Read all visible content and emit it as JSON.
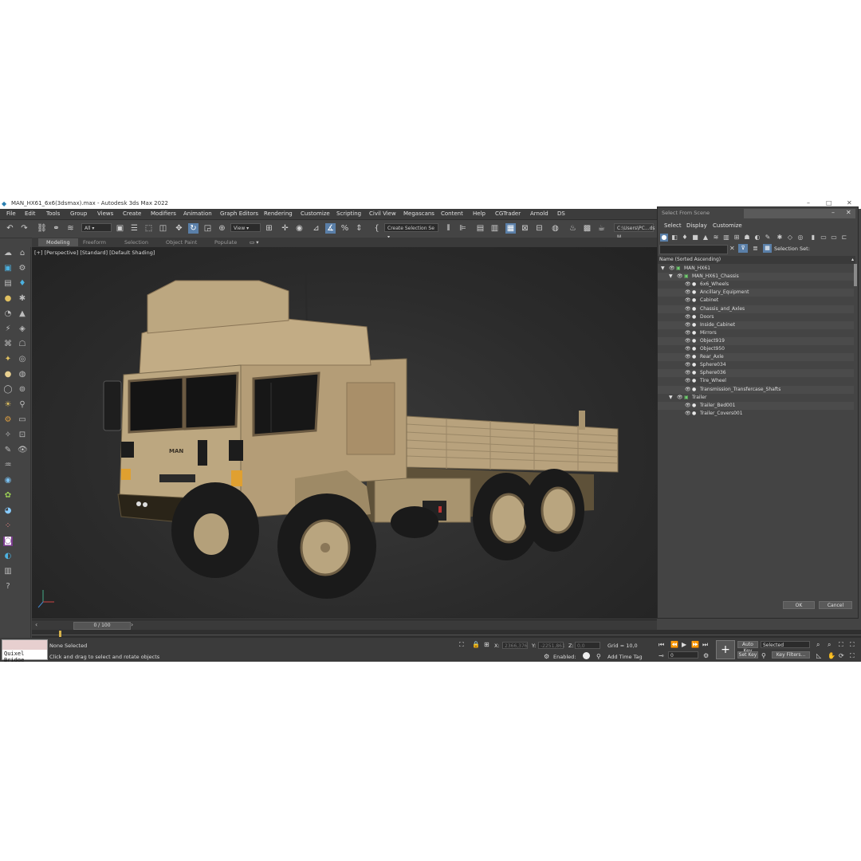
{
  "window": {
    "title": "MAN_HX61_6x6(3dsmax).max - Autodesk 3ds Max 2022"
  },
  "menu": [
    "File",
    "Edit",
    "Tools",
    "Group",
    "Views",
    "Create",
    "Modifiers",
    "Animation",
    "Graph Editors",
    "Rendering",
    "Customize",
    "Scripting",
    "Civil View",
    "Megascans",
    "Content",
    "Help",
    "CGTrader",
    "Arnold",
    "DS"
  ],
  "toolbar": {
    "filter_value": "All",
    "ref_coord_value": "View",
    "named_selection": "Create Selection Se",
    "path": "C:\\Users\\PC...ds M"
  },
  "ribbon": {
    "tabs": [
      "Modeling",
      "Freeform",
      "Selection",
      "Object Paint",
      "Populate"
    ]
  },
  "viewport": {
    "label": "[+] [Perspective] [Standard] [Default Shading]"
  },
  "timeline": {
    "frame": "0 / 100"
  },
  "status": {
    "quixel": "Quixel Bridge",
    "selection": "None Selected",
    "prompt": "Click and drag to select and rotate objects",
    "x_label": "X:",
    "x_value": "2366,376",
    "y_label": "Y:",
    "y_value": "-2251,861",
    "z_label": "Z:",
    "z_value": "0,0",
    "grid": "Grid = 10,0",
    "enabled": "Enabled:",
    "add_time_tag": "Add Time Tag",
    "auto_key": "Auto Key",
    "selected": "Selected",
    "set_key": "Set Key",
    "key_filters": "Key Filters...",
    "frame_field": "0"
  },
  "dialog": {
    "title": "Select From Scene",
    "menu": [
      "Select",
      "Display",
      "Customize"
    ],
    "selection_set": "Selection Set:",
    "column_header": "Name (Sorted Ascending)",
    "tree": [
      {
        "label": "MAN_HX61",
        "level": 0,
        "type": "group"
      },
      {
        "label": "MAN_HX61_Chassis",
        "level": 1,
        "type": "group"
      },
      {
        "label": "6x6_Wheels",
        "level": 2,
        "type": "object"
      },
      {
        "label": "Ancillary_Equipment",
        "level": 2,
        "type": "object"
      },
      {
        "label": "Cabinet",
        "level": 2,
        "type": "object"
      },
      {
        "label": "Chassis_and_Axles",
        "level": 2,
        "type": "object"
      },
      {
        "label": "Doors",
        "level": 2,
        "type": "object"
      },
      {
        "label": "Inside_Cabinet",
        "level": 2,
        "type": "object"
      },
      {
        "label": "Mirrors",
        "level": 2,
        "type": "object"
      },
      {
        "label": "Object919",
        "level": 2,
        "type": "object"
      },
      {
        "label": "Object950",
        "level": 2,
        "type": "object"
      },
      {
        "label": "Rear_Axle",
        "level": 2,
        "type": "object"
      },
      {
        "label": "Sphere034",
        "level": 2,
        "type": "object"
      },
      {
        "label": "Sphere036",
        "level": 2,
        "type": "object"
      },
      {
        "label": "Tire_Wheel",
        "level": 2,
        "type": "object"
      },
      {
        "label": "Transmission_Transfercase_Shafts",
        "level": 2,
        "type": "object"
      },
      {
        "label": "Trailer",
        "level": 1,
        "type": "group"
      },
      {
        "label": "Trailer_Bed001",
        "level": 2,
        "type": "object"
      },
      {
        "label": "Trailer_Covers001",
        "level": 2,
        "type": "object"
      }
    ],
    "ok": "OK",
    "cancel": "Cancel"
  },
  "truck": {
    "badge": "MAN"
  }
}
